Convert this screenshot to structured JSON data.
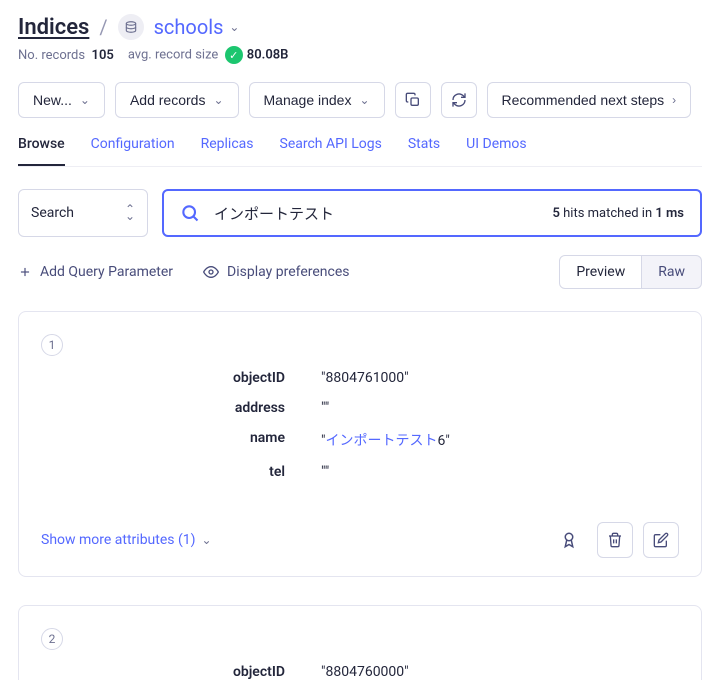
{
  "header": {
    "breadcrumb_root": "Indices",
    "index_name": "schools",
    "records_label": "No. records",
    "records_count": "105",
    "avg_label": "avg. record size",
    "avg_value": "80.08B"
  },
  "toolbar": {
    "new": "New...",
    "add_records": "Add records",
    "manage_index": "Manage index",
    "recommended": "Recommended next steps"
  },
  "tabs": [
    "Browse",
    "Configuration",
    "Replicas",
    "Search API Logs",
    "Stats",
    "UI Demos"
  ],
  "search": {
    "mode_label": "Search",
    "query": "インポートテスト",
    "hits_count": "5",
    "hits_mid": " hits matched in ",
    "hits_time": "1 ms"
  },
  "options": {
    "add_param": "Add Query Parameter",
    "display_prefs": "Display preferences",
    "preview": "Preview",
    "raw": "Raw"
  },
  "records": [
    {
      "num": "1",
      "attrs": {
        "objectID": {
          "label": "objectID",
          "value": "\"8804761000\""
        },
        "address": {
          "label": "address",
          "value": "\"\""
        },
        "name": {
          "label": "name",
          "prefix": "\"",
          "hl": "インポートテスト",
          "suffix": "6\""
        },
        "tel": {
          "label": "tel",
          "value": "\"\""
        }
      },
      "show_more": "Show more attributes (1)"
    },
    {
      "num": "2",
      "attrs": {
        "objectID": {
          "label": "objectID",
          "value": "\"8804760000\""
        }
      }
    }
  ]
}
